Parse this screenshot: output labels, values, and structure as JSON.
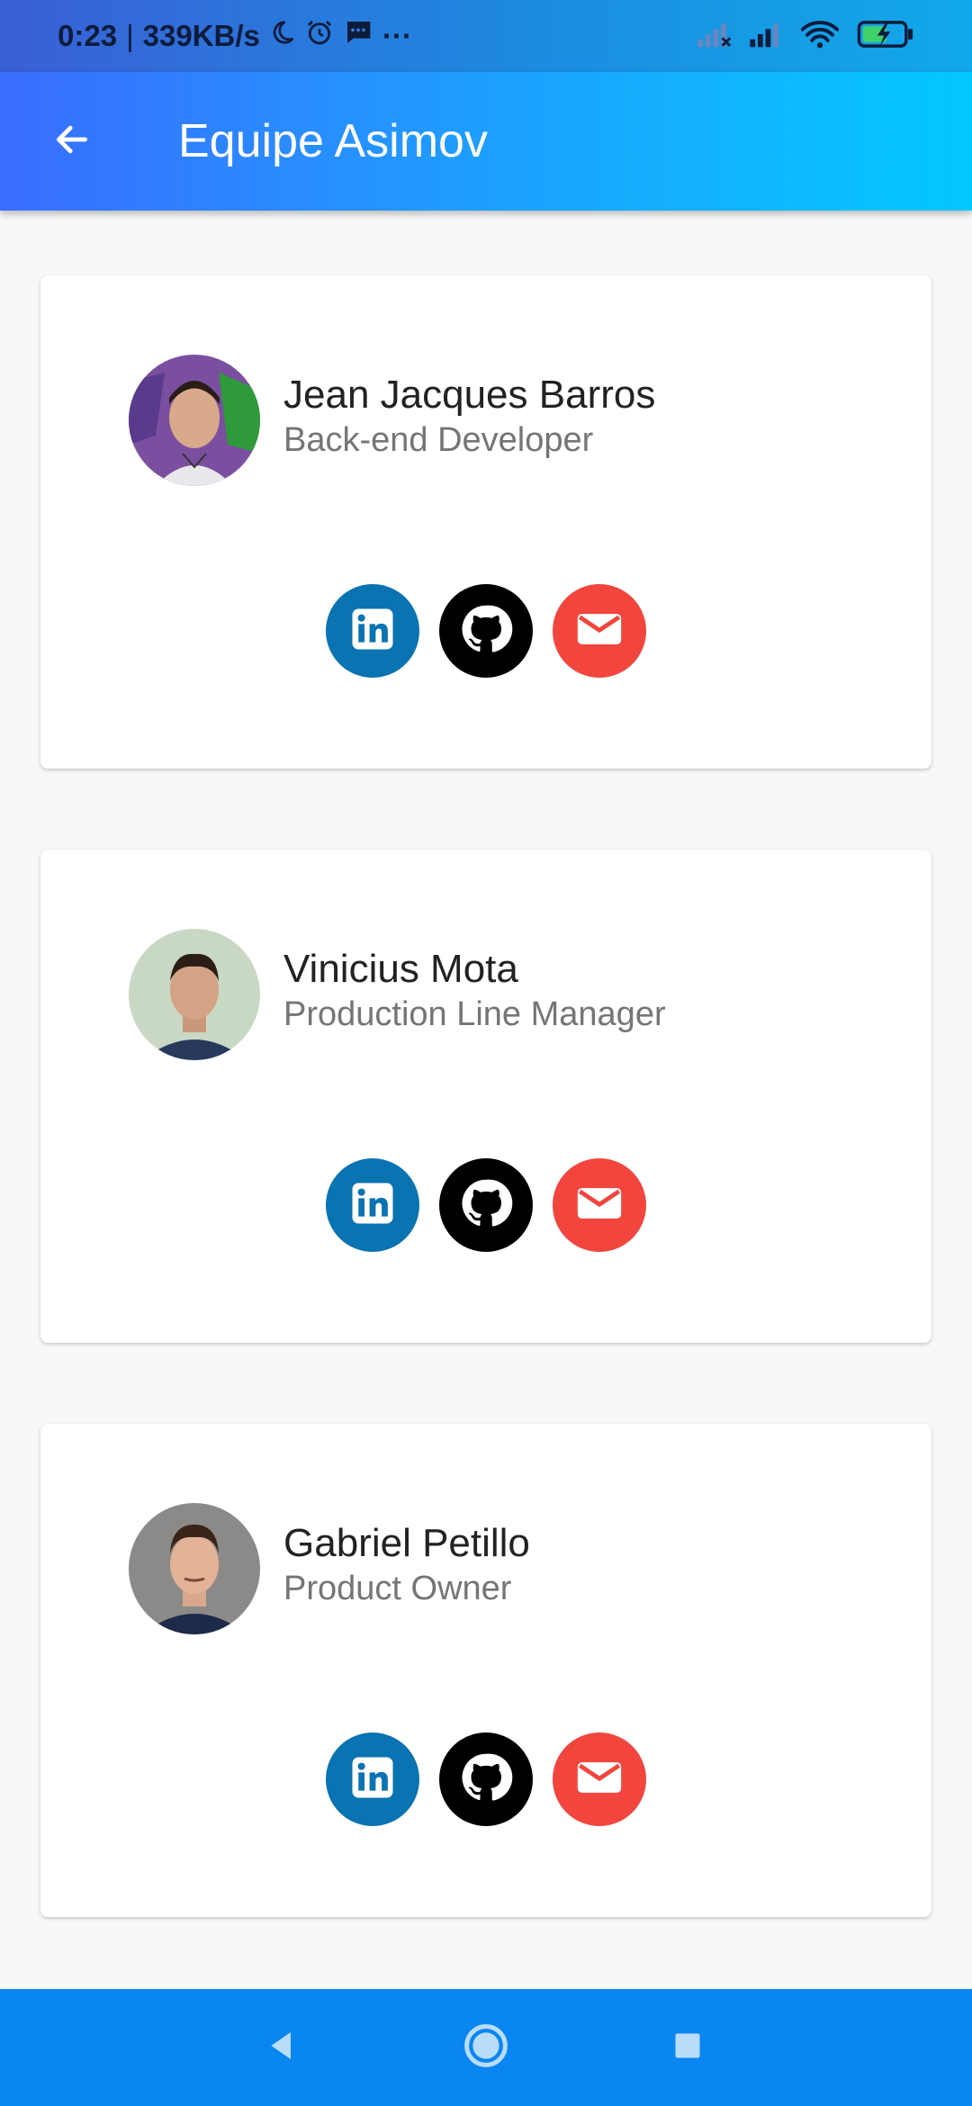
{
  "status_bar": {
    "time": "0:23",
    "separator": "|",
    "speed": "339KB/s",
    "more": "···"
  },
  "app_bar": {
    "title": "Equipe Asimov"
  },
  "team": [
    {
      "name": "Jean Jacques Barros",
      "role": "Back-end Developer",
      "avatar_bg": "#7b4fa0"
    },
    {
      "name": "Vinicius Mota",
      "role": "Production Line Manager",
      "avatar_bg": "#c9d8c4"
    },
    {
      "name": "Gabriel Petillo",
      "role": "Product Owner",
      "avatar_bg": "#8c8a88"
    }
  ],
  "icons": {
    "linkedin": "linkedin-icon",
    "github": "github-icon",
    "email": "email-icon"
  },
  "colors": {
    "linkedin": "#0a73b1",
    "github": "#000000",
    "email": "#f1453d",
    "nav_bar": "#0a86f0"
  }
}
